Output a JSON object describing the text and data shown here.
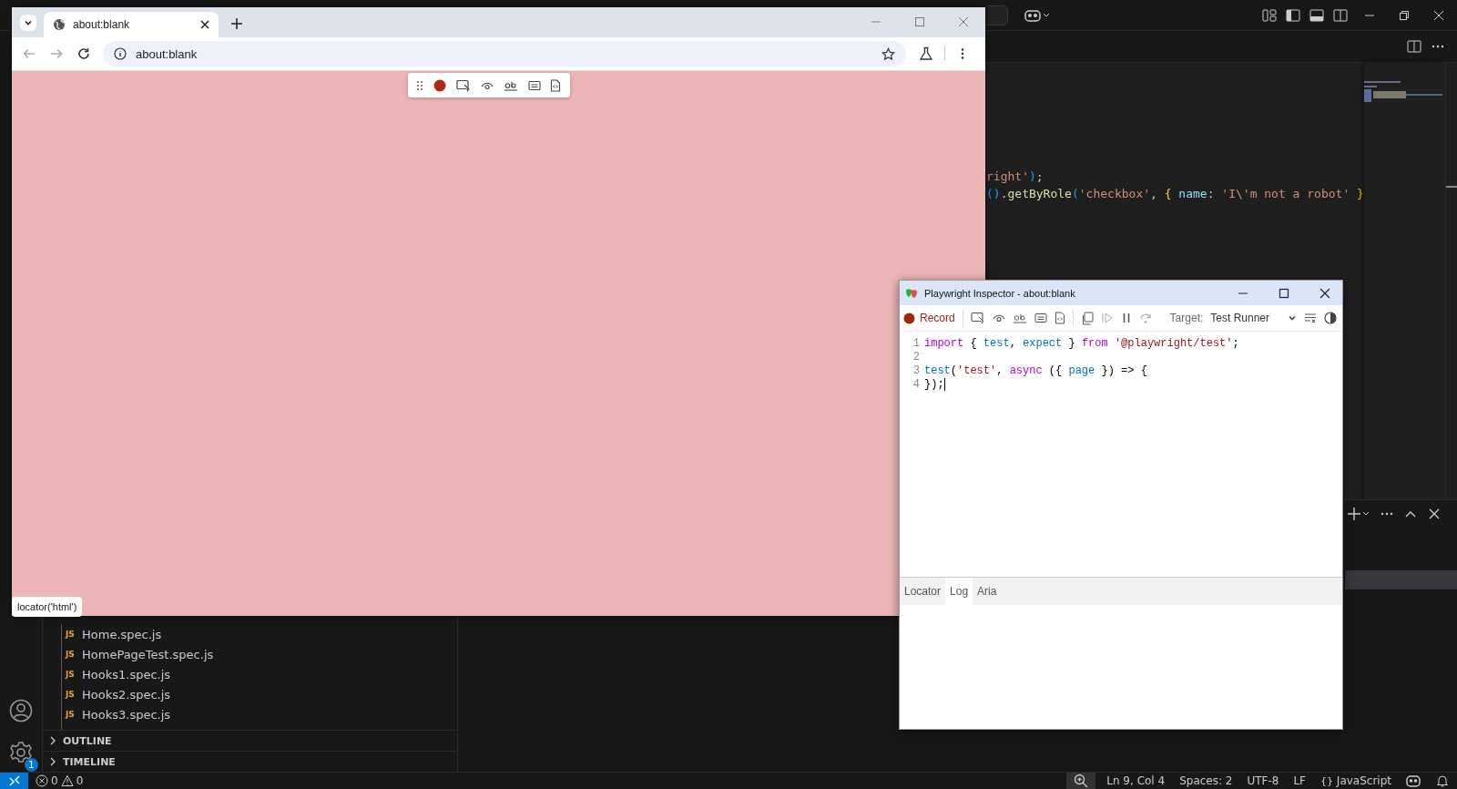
{
  "vscode": {
    "explorer": {
      "files": [
        {
          "badge": "JS",
          "name": "Home.spec.js"
        },
        {
          "badge": "JS",
          "name": "HomePageTest.spec.js"
        },
        {
          "badge": "JS",
          "name": "Hooks1.spec.js"
        },
        {
          "badge": "JS",
          "name": "Hooks2.spec.js"
        },
        {
          "badge": "JS",
          "name": "Hooks3.spec.js"
        }
      ],
      "sections": [
        {
          "label": "OUTLINE",
          "expanded": false
        },
        {
          "label": "TIMELINE",
          "expanded": false
        }
      ]
    },
    "settings_badge": "1",
    "editor_lines": [
      [
        {
          "kind": "string",
          "text": "right'"
        },
        {
          "kind": "bracket1",
          "text": ")"
        },
        {
          "kind": "plain",
          "text": ";"
        }
      ],
      [
        {
          "kind": "bracket1",
          "text": "()"
        },
        {
          "kind": "plain",
          "text": "."
        },
        {
          "kind": "function",
          "text": "getByRole"
        },
        {
          "kind": "bracket1",
          "text": "("
        },
        {
          "kind": "string",
          "text": "'checkbox'"
        },
        {
          "kind": "plain",
          "text": ", "
        },
        {
          "kind": "bracket2",
          "text": "{"
        },
        {
          "kind": "property",
          "text": " name"
        },
        {
          "kind": "plain",
          "text": ": "
        },
        {
          "kind": "string",
          "text": "'I\\'m not a robot'"
        },
        {
          "kind": "bracket2",
          "text": " }"
        }
      ]
    ],
    "status_bar": {
      "errors": "0",
      "warnings": "0",
      "items": [
        {
          "kind": "text",
          "text": "Ln 9, Col 4"
        },
        {
          "kind": "text",
          "text": "Spaces: 2"
        },
        {
          "kind": "text",
          "text": "UTF-8"
        },
        {
          "kind": "text",
          "text": "LF"
        },
        {
          "kind": "language",
          "icon": "{}",
          "text": "JavaScript"
        }
      ]
    }
  },
  "browser": {
    "tab_title": "about:blank",
    "address": "about:blank",
    "tooltip": "locator('html')"
  },
  "inspector": {
    "title": "Playwright Inspector - about:blank",
    "record_label": "Record",
    "target_label": "Target:",
    "target": "Test Runner",
    "code": [
      {
        "number": "1",
        "tokens": [
          {
            "kind": "keyword",
            "text": "import"
          },
          {
            "kind": "plain",
            "text": " { "
          },
          {
            "kind": "ident",
            "text": "test"
          },
          {
            "kind": "plain",
            "text": ", "
          },
          {
            "kind": "ident",
            "text": "expect"
          },
          {
            "kind": "plain",
            "text": " } "
          },
          {
            "kind": "keyword",
            "text": "from"
          },
          {
            "kind": "string",
            "text": " '@playwright/test'"
          },
          {
            "kind": "plain",
            "text": ";"
          }
        ]
      },
      {
        "number": "2"
      },
      {
        "number": "3",
        "tokens": [
          {
            "kind": "ident",
            "text": "test"
          },
          {
            "kind": "plain",
            "text": "("
          },
          {
            "kind": "string",
            "text": "'test'"
          },
          {
            "kind": "plain",
            "text": ", "
          },
          {
            "kind": "keyword",
            "text": "async"
          },
          {
            "kind": "plain",
            "text": " ({ "
          },
          {
            "kind": "ident",
            "text": "page"
          },
          {
            "kind": "plain",
            "text": " }) => {"
          }
        ]
      },
      {
        "number": "4",
        "tokens": [
          {
            "kind": "plain",
            "text": "});"
          }
        ]
      }
    ],
    "tabs": [
      {
        "label": "Locator",
        "selected": false
      },
      {
        "label": "Log",
        "selected": true
      },
      {
        "label": "Aria",
        "selected": false
      }
    ]
  }
}
